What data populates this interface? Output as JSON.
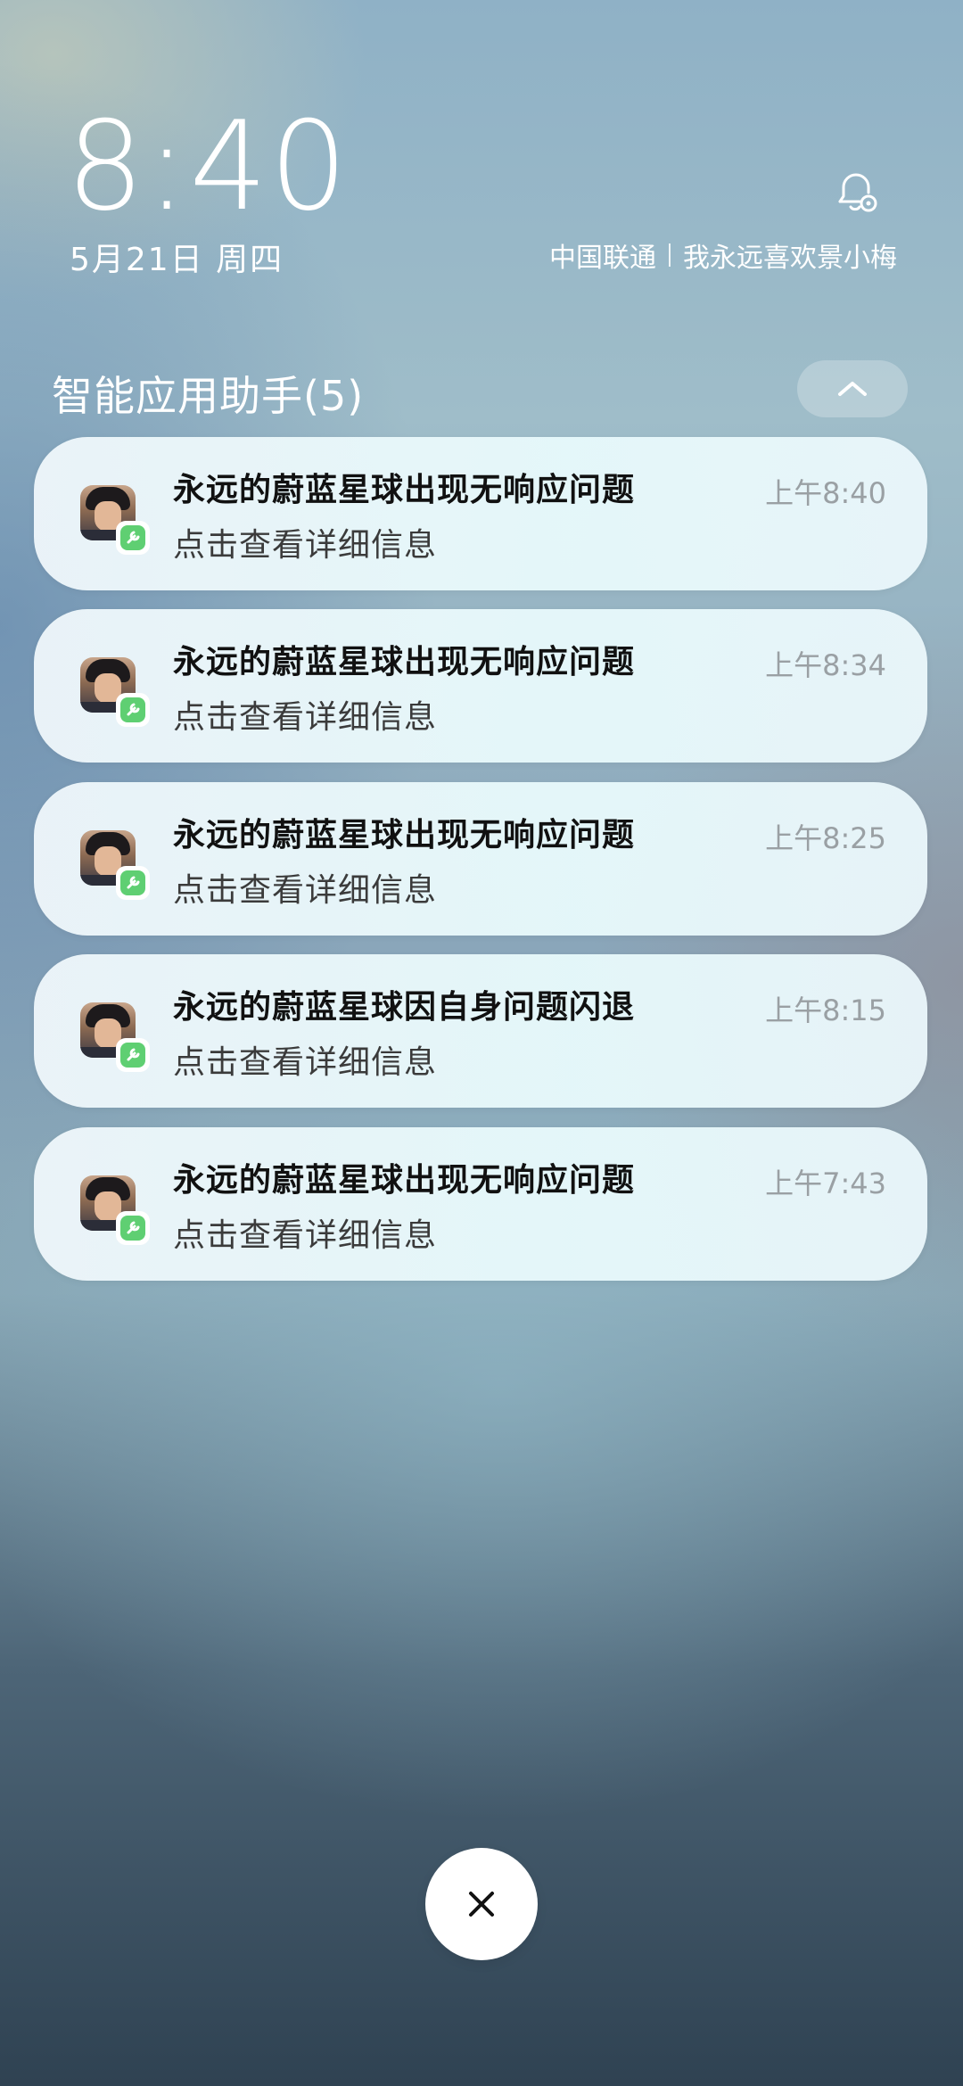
{
  "lockscreen": {
    "time": "8:40",
    "date": "5月21日 周四",
    "carrier": "中国联通",
    "owner_text": "我永远喜欢景小梅"
  },
  "group": {
    "title": "智能应用助手(5)"
  },
  "notifications": [
    {
      "title": "永远的蔚蓝星球出现无响应问题",
      "body": "点击查看详细信息",
      "time": "上午8:40"
    },
    {
      "title": "永远的蔚蓝星球出现无响应问题",
      "body": "点击查看详细信息",
      "time": "上午8:34"
    },
    {
      "title": "永远的蔚蓝星球出现无响应问题",
      "body": "点击查看详细信息",
      "time": "上午8:25"
    },
    {
      "title": "永远的蔚蓝星球因自身问题闪退",
      "body": "点击查看详细信息",
      "time": "上午8:15"
    },
    {
      "title": "永远的蔚蓝星球出现无响应问题",
      "body": "点击查看详细信息",
      "time": "上午7:43"
    }
  ],
  "icons": {
    "bell": "bell-settings-icon",
    "collapse": "chevron-up-icon",
    "close": "close-icon",
    "badge": "wrench-icon"
  },
  "colors": {
    "badge_green": "#5fcf72",
    "card_bg": "#eef7fa",
    "time_gray": "#9aa0a4"
  }
}
